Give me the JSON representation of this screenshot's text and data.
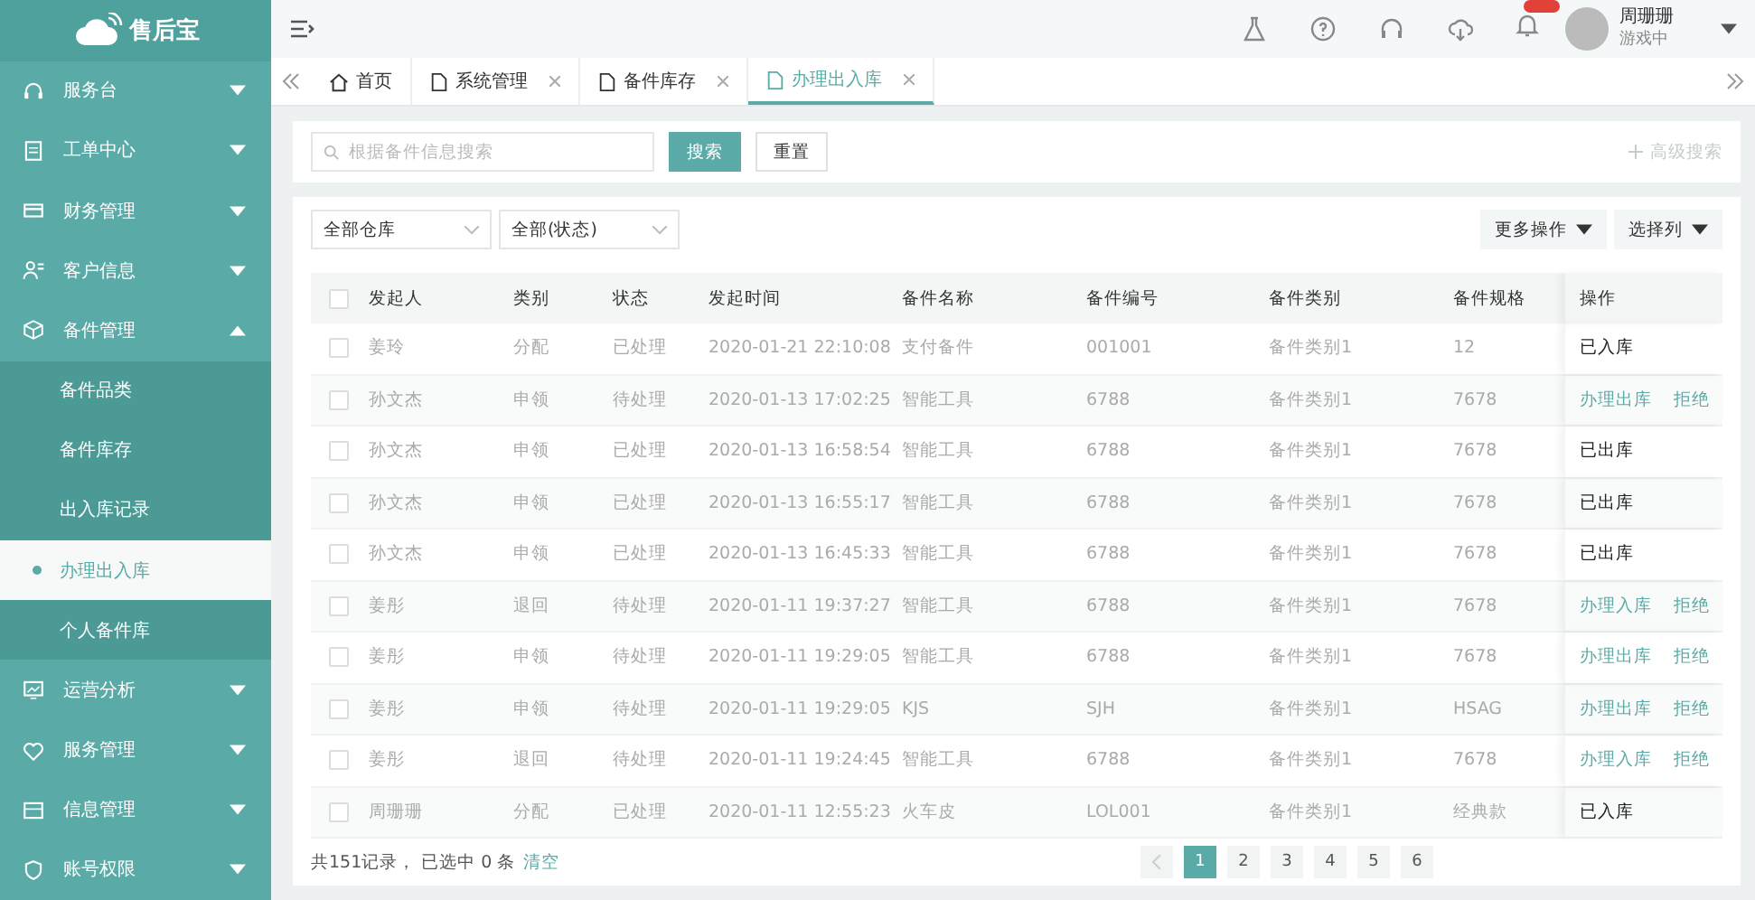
{
  "logo": {
    "text": "售后宝"
  },
  "sidebar": {
    "items": [
      {
        "label": "服务台",
        "expanded": false
      },
      {
        "label": "工单中心",
        "expanded": false
      },
      {
        "label": "财务管理",
        "expanded": false
      },
      {
        "label": "客户信息",
        "expanded": false
      },
      {
        "label": "备件管理",
        "expanded": true,
        "children": [
          {
            "label": "备件品类",
            "selected": false
          },
          {
            "label": "备件库存",
            "selected": false
          },
          {
            "label": "出入库记录",
            "selected": false
          },
          {
            "label": "办理出入库",
            "selected": true
          },
          {
            "label": "个人备件库",
            "selected": false
          }
        ]
      },
      {
        "label": "运营分析",
        "expanded": false
      },
      {
        "label": "服务管理",
        "expanded": false
      },
      {
        "label": "信息管理",
        "expanded": false
      },
      {
        "label": "账号权限",
        "expanded": false
      }
    ]
  },
  "header": {
    "user": {
      "name": "周珊珊",
      "status": "游戏中"
    }
  },
  "tabs": [
    {
      "label": "首页",
      "kind": "home",
      "selected": false,
      "closable": false
    },
    {
      "label": "系统管理",
      "kind": "page",
      "selected": false,
      "closable": true
    },
    {
      "label": "备件库存",
      "kind": "page",
      "selected": false,
      "closable": true
    },
    {
      "label": "办理出入库",
      "kind": "page",
      "selected": true,
      "closable": true
    }
  ],
  "search": {
    "placeholder": "根据备件信息搜索",
    "search_button": "搜索",
    "reset_button": "重置",
    "advanced": "高级搜索"
  },
  "filters": [
    {
      "value": "全部仓库"
    },
    {
      "value": "全部(状态)"
    }
  ],
  "toolbar": {
    "more": "更多操作",
    "columns": "选择列"
  },
  "table": {
    "all_checked": false,
    "columns": [
      "发起人",
      "类别",
      "状态",
      "发起时间",
      "备件名称",
      "备件编号",
      "备件类别",
      "备件规格",
      "操作"
    ],
    "rows": [
      {
        "checked": false,
        "cells": [
          "姜玲",
          "分配",
          "已处理",
          "2020-01-21 22:10:08",
          "支付备件",
          "001001",
          "备件类别1",
          "12"
        ],
        "action": {
          "kind": "status",
          "text": "已入库"
        }
      },
      {
        "checked": false,
        "cells": [
          "孙文杰",
          "申领",
          "待处理",
          "2020-01-13 17:02:25",
          "智能工具",
          "6788",
          "备件类别1",
          "7678"
        ],
        "action": {
          "kind": "links",
          "links": [
            "办理出库",
            "拒绝"
          ]
        }
      },
      {
        "checked": false,
        "cells": [
          "孙文杰",
          "申领",
          "已处理",
          "2020-01-13 16:58:54",
          "智能工具",
          "6788",
          "备件类别1",
          "7678"
        ],
        "action": {
          "kind": "status",
          "text": "已出库"
        }
      },
      {
        "checked": false,
        "cells": [
          "孙文杰",
          "申领",
          "已处理",
          "2020-01-13 16:55:17",
          "智能工具",
          "6788",
          "备件类别1",
          "7678"
        ],
        "action": {
          "kind": "status",
          "text": "已出库"
        }
      },
      {
        "checked": false,
        "cells": [
          "孙文杰",
          "申领",
          "已处理",
          "2020-01-13 16:45:33",
          "智能工具",
          "6788",
          "备件类别1",
          "7678"
        ],
        "action": {
          "kind": "status",
          "text": "已出库"
        }
      },
      {
        "checked": false,
        "cells": [
          "姜彤",
          "退回",
          "待处理",
          "2020-01-11 19:37:27",
          "智能工具",
          "6788",
          "备件类别1",
          "7678"
        ],
        "action": {
          "kind": "links",
          "links": [
            "办理入库",
            "拒绝"
          ]
        }
      },
      {
        "checked": false,
        "cells": [
          "姜彤",
          "申领",
          "待处理",
          "2020-01-11 19:29:05",
          "智能工具",
          "6788",
          "备件类别1",
          "7678"
        ],
        "action": {
          "kind": "links",
          "links": [
            "办理出库",
            "拒绝"
          ]
        }
      },
      {
        "checked": false,
        "cells": [
          "姜彤",
          "申领",
          "待处理",
          "2020-01-11 19:29:05",
          "KJS",
          "SJH",
          "备件类别1",
          "HSAG"
        ],
        "action": {
          "kind": "links",
          "links": [
            "办理出库",
            "拒绝"
          ]
        }
      },
      {
        "checked": false,
        "cells": [
          "姜彤",
          "退回",
          "待处理",
          "2020-01-11 19:24:45",
          "智能工具",
          "6788",
          "备件类别1",
          "7678"
        ],
        "action": {
          "kind": "links",
          "links": [
            "办理入库",
            "拒绝"
          ]
        }
      },
      {
        "checked": false,
        "cells": [
          "周珊珊",
          "分配",
          "已处理",
          "2020-01-11 12:55:23",
          "火车皮",
          "LOL001",
          "备件类别1",
          "经典款"
        ],
        "action": {
          "kind": "status",
          "text": "已入库"
        }
      }
    ]
  },
  "footer": {
    "summary": "共151记录， 已选中 0 条",
    "clear": "清空",
    "pages": [
      {
        "label": "1",
        "selected": true
      },
      {
        "label": "2",
        "selected": false
      },
      {
        "label": "3",
        "selected": false
      },
      {
        "label": "4",
        "selected": false
      },
      {
        "label": "5",
        "selected": false
      },
      {
        "label": "6",
        "selected": false
      }
    ]
  }
}
